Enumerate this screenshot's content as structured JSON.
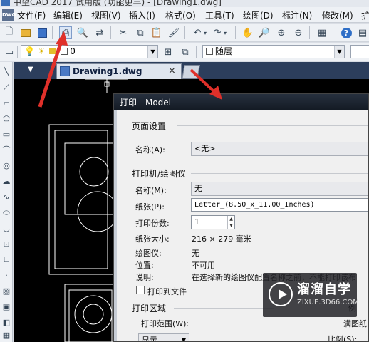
{
  "window": {
    "title": "中望CAD 2017 试用版 (功能更丰) - [Drawing1.dwg]"
  },
  "menu": [
    {
      "label": "文件(F)"
    },
    {
      "label": "编辑(E)"
    },
    {
      "label": "视图(V)"
    },
    {
      "label": "插入(I)"
    },
    {
      "label": "格式(O)"
    },
    {
      "label": "工具(T)"
    },
    {
      "label": "绘图(D)"
    },
    {
      "label": "标注(N)"
    },
    {
      "label": "修改(M)"
    },
    {
      "label": "扩"
    }
  ],
  "layer_bar": {
    "layer_value": "0",
    "linetype_value": "随层"
  },
  "document_tab": {
    "label": "Drawing1.dwg",
    "close": "×"
  },
  "dialog": {
    "title": "打印 - Model",
    "page_setup": {
      "group": "页面设置",
      "name_label": "名称(A):",
      "name_value": "<无>"
    },
    "printer": {
      "group": "打印机/绘图仪",
      "name_label": "名称(M):",
      "name_value": "无",
      "paper_label": "纸张(P):",
      "paper_value": "Letter_(8.50_x_11.00_Inches)",
      "copies_label": "打印份数:",
      "copies_value": "1",
      "size_label": "纸张大小:",
      "size_value": "216 × 279  毫米",
      "plotter_label": "绘图仪:",
      "plotter_value": "无",
      "location_label": "位置:",
      "location_value": "不可用",
      "desc_label": "说明:",
      "desc_value": "在选择新的绘图仪配置名称之前，不能打印该布",
      "print_to_file": "打印到文件"
    },
    "area": {
      "group": "打印区域",
      "range_label": "打印范围(W):",
      "range_value": "显示"
    },
    "right_fragments": {
      "a": "例",
      "b": "满图纸",
      "c": "比例(S):"
    }
  },
  "watermark": {
    "title": "溜溜自学",
    "url": "ZIXUE.3D66.COM"
  },
  "colors": {
    "canvas": "#000000",
    "annotation_arrow": "#e0302a",
    "dialog_title": "#1c2430"
  }
}
